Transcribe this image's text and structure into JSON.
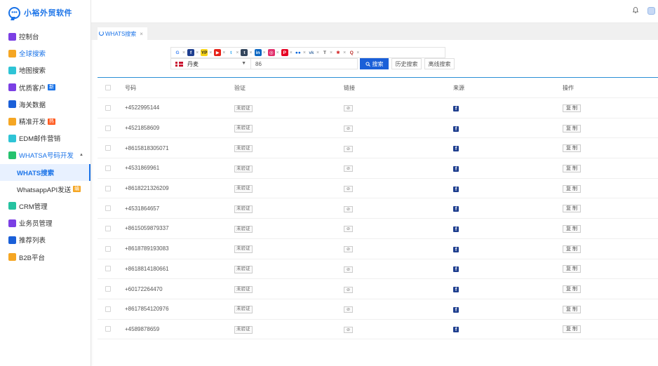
{
  "app": {
    "title": "小裕外贸软件",
    "logo_glyph": "•••"
  },
  "sidebar": {
    "items": [
      {
        "label": "控制台",
        "icon": "monitor-chart-icon",
        "color": "#7b3fe4"
      },
      {
        "label": "全球搜索",
        "icon": "globe-icon",
        "color": "#f5a623"
      },
      {
        "label": "地图搜索",
        "icon": "map-icon",
        "color": "#2ec4d6"
      },
      {
        "label": "优质客户",
        "icon": "book-icon",
        "color": "#7b3fe4",
        "badge": "新",
        "badge_color": "#1a73e8"
      },
      {
        "label": "海关数据",
        "icon": "compass-icon",
        "color": "#1a5fd8"
      },
      {
        "label": "精准开发",
        "icon": "user-target-icon",
        "color": "#f5a623",
        "badge": "热",
        "badge_color": "#ff5a1f"
      },
      {
        "label": "EDM邮件营销",
        "icon": "mail-icon",
        "color": "#2ec4d6"
      },
      {
        "label": "WHATSA号码开发",
        "icon": "whatsapp-icon",
        "color": "#25c26e",
        "arrow": "▲"
      }
    ],
    "subitems": [
      {
        "label": "WHATS搜索"
      },
      {
        "label": "WhatsappAPI发送",
        "badge": "编",
        "badge_color": "#f5a623"
      }
    ],
    "items_after": [
      {
        "label": "CRM管理",
        "icon": "person-icon",
        "color": "#25c2a0"
      },
      {
        "label": "业务员管理",
        "icon": "briefcase-icon",
        "color": "#7b3fe4"
      },
      {
        "label": "推荐列表",
        "icon": "network-icon",
        "color": "#1a5fd8"
      },
      {
        "label": "B2B平台",
        "icon": "b2b-icon",
        "color": "#f5a623"
      }
    ]
  },
  "tab": {
    "label": "WHATS搜索",
    "close": "×"
  },
  "social_filters": [
    {
      "name": "google-icon",
      "glyph": "G",
      "color": "#ffffff",
      "fg": "#4285f4"
    },
    {
      "name": "facebook-icon",
      "glyph": "f",
      "color": "#1f3f8f",
      "fg": "#ffffff"
    },
    {
      "name": "yellowpages-icon",
      "glyph": "YP",
      "color": "#f7d417",
      "fg": "#222222"
    },
    {
      "name": "youtube-icon",
      "glyph": "▶",
      "color": "#e62117",
      "fg": "#ffffff"
    },
    {
      "name": "twitter-icon",
      "glyph": "t",
      "color": "#ffffff",
      "fg": "#1da1f2"
    },
    {
      "name": "tumblr-icon",
      "glyph": "t",
      "color": "#34465d",
      "fg": "#ffffff"
    },
    {
      "name": "linkedin-icon",
      "glyph": "in",
      "color": "#0a66c2",
      "fg": "#ffffff"
    },
    {
      "name": "instagram-icon",
      "glyph": "◎",
      "color": "#e1306c",
      "fg": "#ffffff"
    },
    {
      "name": "pinterest-icon",
      "glyph": "P",
      "color": "#e60023",
      "fg": "#ffffff"
    },
    {
      "name": "flickr-icon",
      "glyph": "●●",
      "color": "#ffffff",
      "fg": "#0063dc"
    },
    {
      "name": "vk-icon",
      "glyph": "vk",
      "color": "#ffffff",
      "fg": "#4a76a8"
    },
    {
      "name": "tumblr-text-icon",
      "glyph": "T",
      "color": "#ffffff",
      "fg": "#555555"
    },
    {
      "name": "yelp-icon",
      "glyph": "✱",
      "color": "#ffffff",
      "fg": "#d32323"
    },
    {
      "name": "quora-icon",
      "glyph": "Q",
      "color": "#ffffff",
      "fg": "#b92b27"
    }
  ],
  "social_close": "×",
  "search": {
    "country": "丹麦",
    "caret": "▼",
    "code_value": "86",
    "search_button": "搜索",
    "history_button": "历史搜索",
    "offline_button": "离线搜索"
  },
  "table": {
    "headers": {
      "number": "号码",
      "verify": "验证",
      "link": "链接",
      "source": "来源",
      "action": "操作"
    },
    "verify_tag": "未验证",
    "link_glyph": "⊘",
    "source_glyph": "f",
    "copy_label": "复 制",
    "rows": [
      "+4522995144",
      "+4521858609",
      "+8615818305071",
      "+4531869961",
      "+8618221326209",
      "+4531864657",
      "+8615059879337",
      "+8618789193083",
      "+8618814180661",
      "+60172264470",
      "+8617854120976",
      "+4589878659"
    ]
  }
}
